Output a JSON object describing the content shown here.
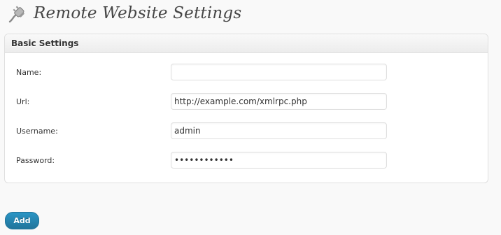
{
  "page": {
    "title": "Remote Website Settings",
    "icon": "plugin-plug-icon"
  },
  "box": {
    "title": "Basic Settings"
  },
  "fields": [
    {
      "label": "Name:",
      "value": "",
      "placeholder": ""
    },
    {
      "label": "Url:",
      "value": "http://example.com/xmlrpc.php",
      "placeholder": ""
    },
    {
      "label": "Username:",
      "value": "admin",
      "placeholder": ""
    },
    {
      "label": "Password:",
      "value": "••••••••••••",
      "placeholder": ""
    }
  ],
  "actions": {
    "add_label": "Add"
  },
  "colors": {
    "primary_button": "#21759b",
    "background": "#f9f9f9",
    "border": "#dfdfdf"
  }
}
